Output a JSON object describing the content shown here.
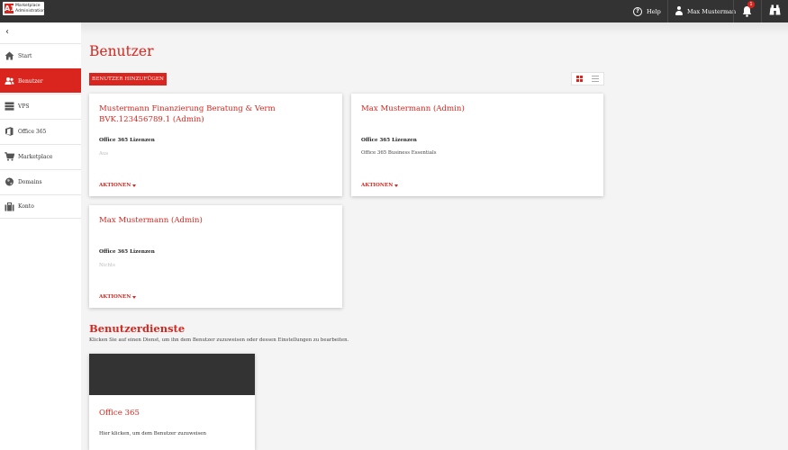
{
  "topbar": {
    "logo_mark": "A1",
    "logo_line1": "Marketplace",
    "logo_line2": "Administration",
    "help_label": "Help",
    "user_name": "Max Musterman",
    "notification_count": "1"
  },
  "sidebar": {
    "collapse_glyph": "‹",
    "items": [
      {
        "label": "Start",
        "icon": "home-icon"
      },
      {
        "label": "Benutzer",
        "icon": "users-icon",
        "active": true
      },
      {
        "label": "VPS",
        "icon": "server-icon"
      },
      {
        "label": "Office 365",
        "icon": "office-icon"
      },
      {
        "label": "Marketplace",
        "icon": "cart-icon"
      },
      {
        "label": "Domains",
        "icon": "globe-icon"
      },
      {
        "label": "Konto",
        "icon": "briefcase-icon"
      }
    ]
  },
  "main": {
    "title": "Benutzer",
    "add_button": "BENUTZER HINZUFÜGEN",
    "cards": [
      {
        "title": "Mustermann Finanzierung Beratung & Verm BVK.123456789.1 (Admin)",
        "label": "Office 365 Lizenzen",
        "value": "Aus",
        "action": "AKTIONEN"
      },
      {
        "title": "Max Mustermann (Admin)",
        "label": "Office 365 Lizenzen",
        "value": "Office 365 Business Essentials",
        "action": "AKTIONEN"
      },
      {
        "title": "Max Mustermann (Admin)",
        "label": "Office 365 Lizenzen",
        "value": "Nichts",
        "action": "AKTIONEN"
      }
    ],
    "services_title": "Benutzerdienste",
    "services_desc": "Klicken Sie auf einen Dienst, um ihn dem Benutzer zuzuweisen oder dessen Einstellungen zu bearbeiten.",
    "service_card": {
      "title": "Office 365",
      "desc": "Hier klicken, um dem Benutzer zuzuweisen"
    }
  },
  "colors": {
    "accent": "#d9251d",
    "topbar": "#333333"
  }
}
